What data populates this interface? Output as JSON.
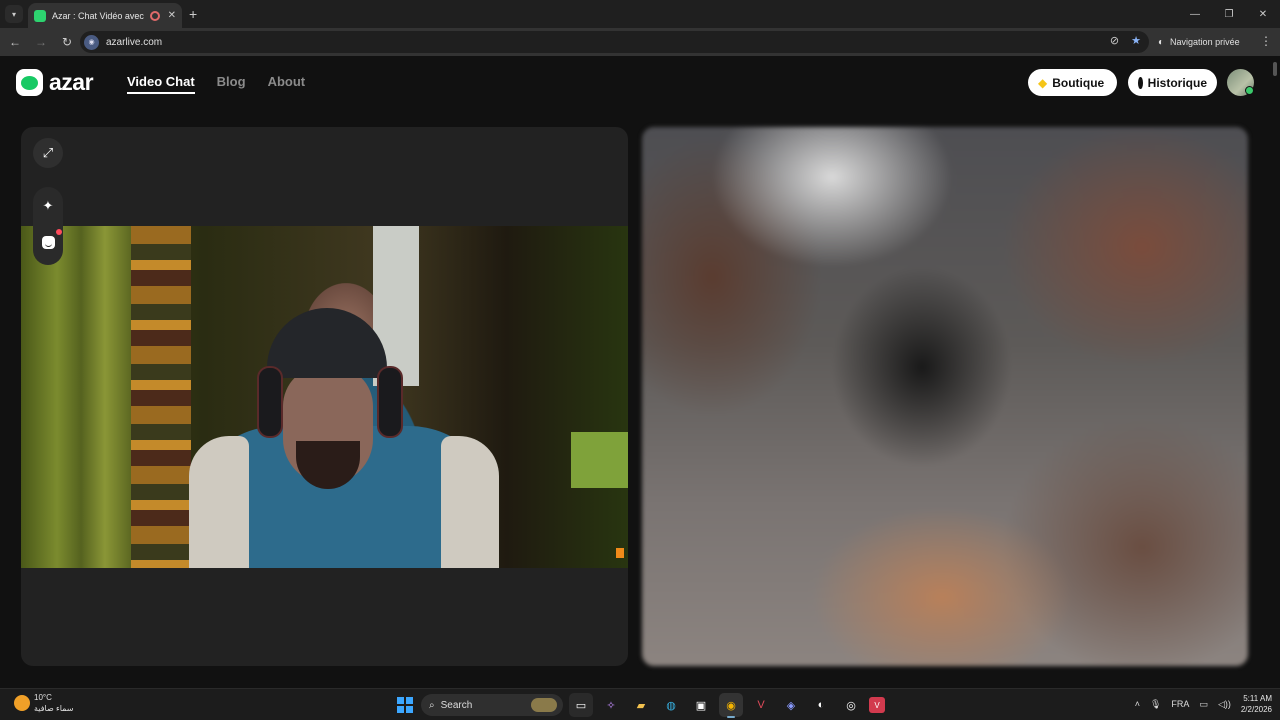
{
  "browser": {
    "tab_title": "Azar : Chat Vidéo avec de n",
    "url": "azarlive.com",
    "incognito_label": "Navigation privée"
  },
  "site": {
    "logo_text": "azar",
    "nav": [
      "Video Chat",
      "Blog",
      "About"
    ],
    "boutique_label": "Boutique",
    "history_label": "Historique"
  },
  "colors": {
    "brand_green": "#17c964",
    "badge_red": "#ff4b5c",
    "boutique_gem": "#f5c518"
  },
  "taskbar": {
    "weather_temp": "10°C",
    "weather_desc": "سماء صافية",
    "search_label": "Search",
    "language": "FRA",
    "time": "5:11 AM",
    "date": "2/2/2026"
  },
  "icons": {
    "expand": "expand-icon",
    "magic": "magic-wand-icon",
    "face": "face-sticker-icon"
  }
}
